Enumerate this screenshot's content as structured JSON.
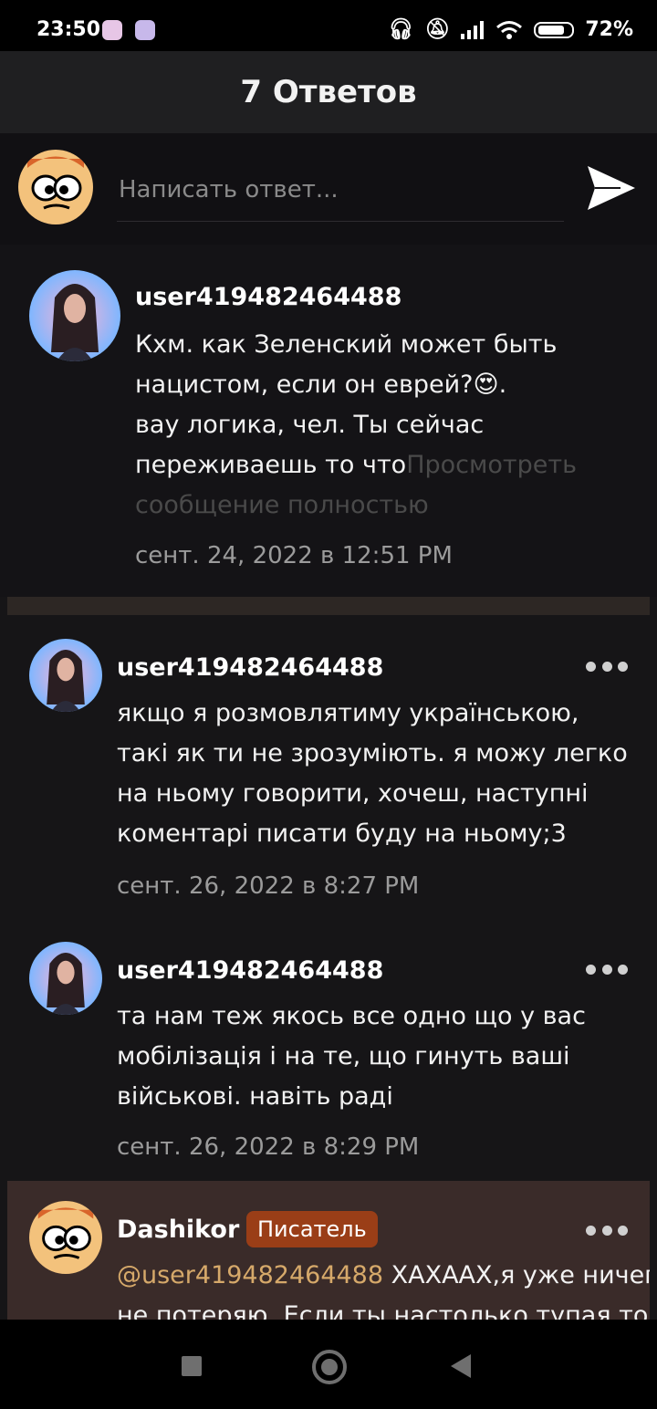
{
  "status_bar": {
    "time": "23:50",
    "battery_percent": "72%"
  },
  "header": {
    "title": "7 Ответов"
  },
  "reply": {
    "placeholder": "Написать ответ..."
  },
  "parent_comment": {
    "username": "user419482464488",
    "text_line1": "Кхм. как Зеленский может быть",
    "text_line2": "нацистом, если он еврей?",
    "text_line2_emoji": "😍",
    "text_line2_end": ".",
    "text_line3": "вау логика, чел. Ты сейчас",
    "text_line4": "переживаешь то что",
    "view_full": "Просмотреть",
    "view_full_2": "сообщение полностью",
    "date": "сент. 24, 2022 в 12:51 PM"
  },
  "replies": [
    {
      "username": "user419482464488",
      "lines": [
        "якщо я розмовлятиму українською,",
        "такі як ти не зрозуміють. я можу легко",
        "на ньому говорити, хочеш, наступні",
        "коментарі писати буду на ньому;3"
      ],
      "date": "сент. 26, 2022 в 8:27 PM"
    },
    {
      "username": "user419482464488",
      "lines": [
        "та нам теж якось все одно що у вас",
        "мобілізація і на те, що гинуть ваші",
        "військові. навіть раді"
      ],
      "date": "сент. 26, 2022 в 8:29 PM"
    },
    {
      "username": "Dashikor",
      "badge": "Писатель",
      "mention": "@user419482464488",
      "line1_rest": " ХАХААХ,я уже ничего",
      "line2": "не потеряю. Если ты настолько тупая то"
    }
  ],
  "colors": {
    "background": "#161517",
    "header": "#1f1f21",
    "highlight": "#3a2b29",
    "badge": "#9a3e17",
    "mention": "#d6a96a",
    "date": "#9b9b9b"
  }
}
